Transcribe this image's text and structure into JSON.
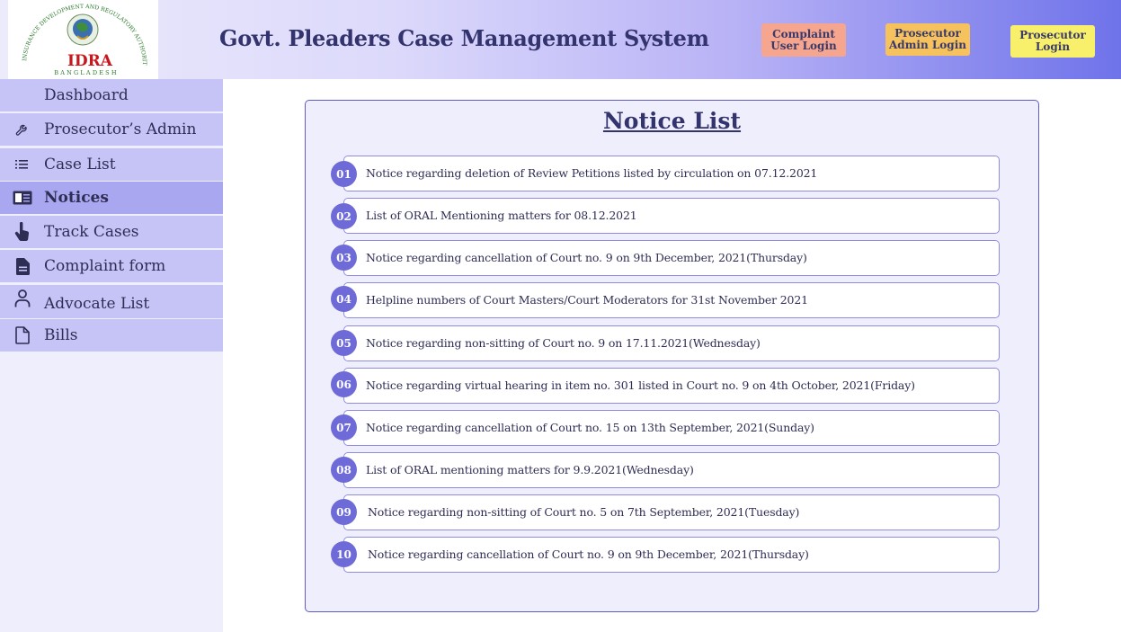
{
  "logo": {
    "arc_text": "INSURANCE DEVELOPMENT AND REGULATORY AUTHORITY",
    "name": "IDRA",
    "country": "BANGLADESH"
  },
  "header": {
    "title": "Govt. Pleaders Case Management System",
    "buttons": [
      {
        "line1": "Complaint",
        "line2": "User Login"
      },
      {
        "line1": "Prosecutor",
        "line2": "Admin Login"
      },
      {
        "line1": "Prosecutor",
        "line2": "Login"
      }
    ]
  },
  "sidebar": {
    "items": [
      {
        "label": "Dashboard",
        "icon": "none"
      },
      {
        "label": "Prosecutor’s Admin",
        "icon": "wrench-icon"
      },
      {
        "label": "Case List",
        "icon": "list-icon"
      },
      {
        "label": "Notices",
        "icon": "notices-icon",
        "active": true
      },
      {
        "label": "Track Cases",
        "icon": "hand-pointer-icon"
      },
      {
        "label": "Complaint form",
        "icon": "document-icon"
      },
      {
        "label": "Advocate List",
        "icon": "person-icon"
      },
      {
        "label": "Bills",
        "icon": "file-icon"
      }
    ]
  },
  "notices": {
    "title": "Notice List",
    "items": [
      {
        "num": "01",
        "text": "Notice regarding deletion of Review Petitions listed by circulation on 07.12.2021"
      },
      {
        "num": "02",
        "text": "List of ORAL Mentioning matters for 08.12.2021"
      },
      {
        "num": "03",
        "text": "Notice regarding cancellation of Court no. 9 on 9th December, 2021(Thursday)"
      },
      {
        "num": "04",
        "text": "Helpline numbers of Court Masters/Court Moderators for 31st November 2021"
      },
      {
        "num": "05",
        "text": "Notice regarding non-sitting  of Court no. 9 on 17.11.2021(Wednesday)"
      },
      {
        "num": "06",
        "text": "Notice regarding virtual hearing in item no. 301 listed in Court no. 9 on 4th October, 2021(Friday)"
      },
      {
        "num": "07",
        "text": "Notice regarding cancellation of Court no. 15 on 13th September, 2021(Sunday)"
      },
      {
        "num": "08",
        "text": "List of ORAL mentioning matters for 9.9.2021(Wednesday)"
      },
      {
        "num": "09",
        "text": "Notice regarding non-sitting of Court no. 5 on 7th September, 2021(Tuesday)"
      },
      {
        "num": "10",
        "text": "Notice regarding cancellation of Court no. 9 on 9th December, 2021(Thursday)"
      }
    ]
  },
  "colors": {
    "accent": "#6e6bd9",
    "sidebar_item": "#c6c4f6",
    "sidebar_active": "#aaa7f1",
    "title_text": "#33336e"
  }
}
